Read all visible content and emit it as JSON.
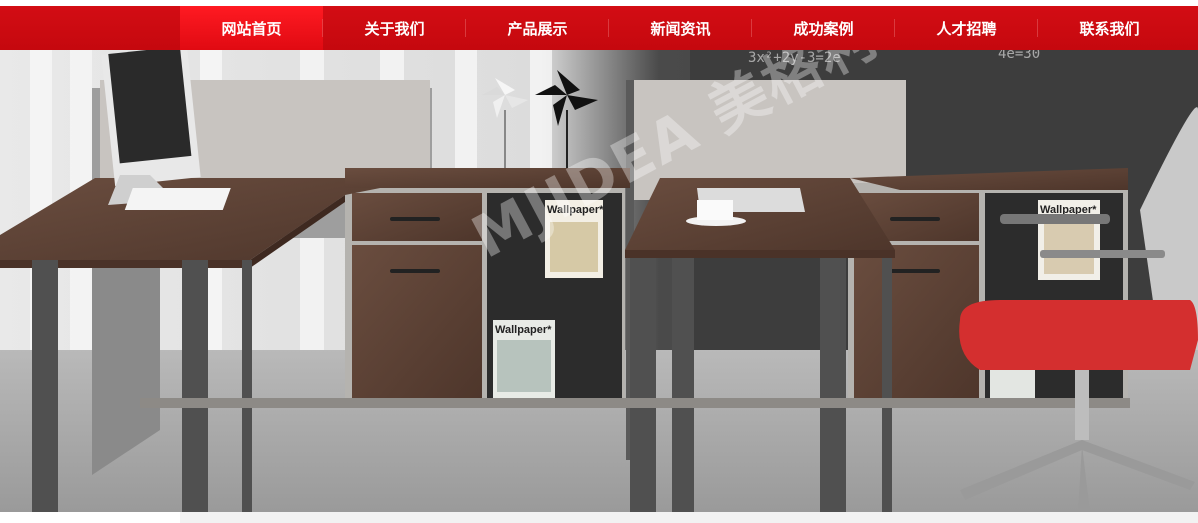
{
  "nav": {
    "items": [
      {
        "label": "网站首页",
        "active": true
      },
      {
        "label": "关于我们",
        "active": false
      },
      {
        "label": "产品展示",
        "active": false
      },
      {
        "label": "新闻资讯",
        "active": false
      },
      {
        "label": "成功案例",
        "active": false
      },
      {
        "label": "人才招聘",
        "active": false
      },
      {
        "label": "联系我们",
        "active": false
      }
    ]
  },
  "banner": {
    "watermark": "MJIDEA 美格利",
    "chalkboard": "3x²+2y-3=2e",
    "chalkboard2": "4e=30",
    "magazine": "Wallpaper*"
  },
  "colors": {
    "nav_bg": "#cc0a10",
    "nav_active": "#f01018",
    "desk_wood": "#5d4037",
    "chair_seat": "#d32f2f"
  }
}
